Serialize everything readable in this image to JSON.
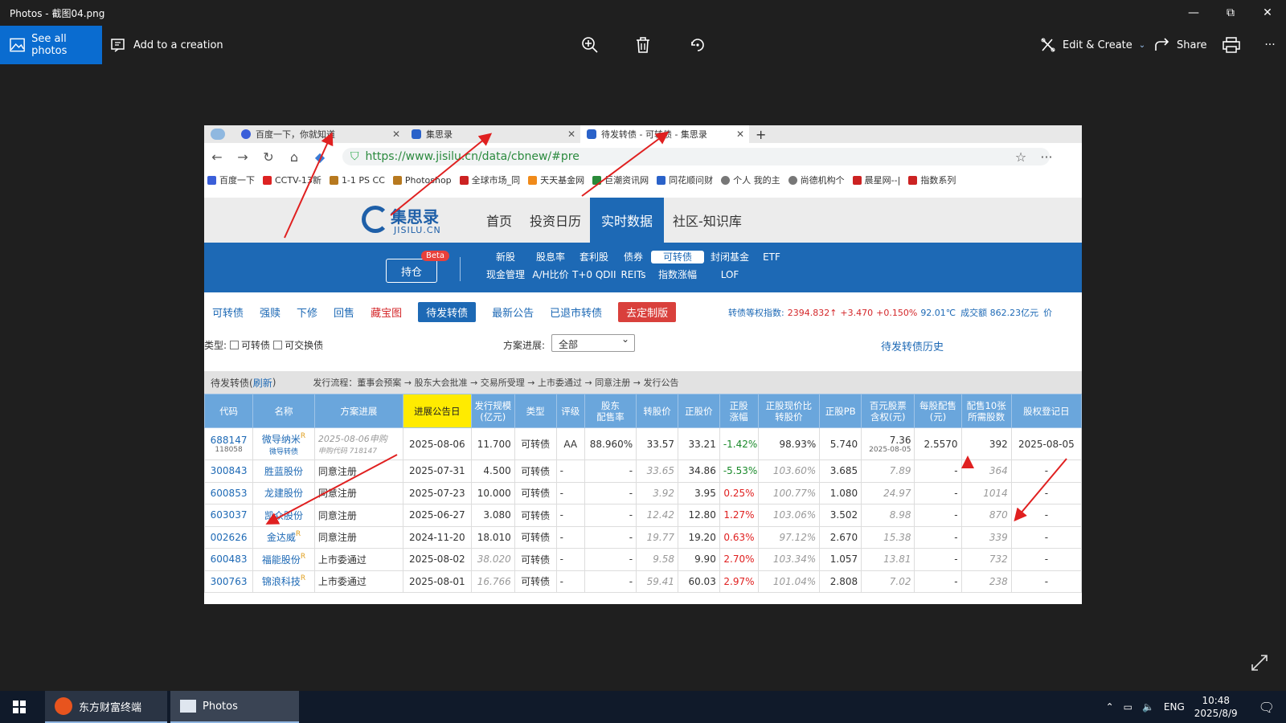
{
  "window": {
    "title": "Photos - 截图04.png",
    "minimize": "—",
    "maximize": "⧉",
    "close": "✕"
  },
  "toolbar": {
    "see_all": "See all photos",
    "add_creation": "Add to a creation",
    "edit_create": "Edit & Create",
    "share": "Share",
    "more": "···"
  },
  "browser": {
    "tabs": [
      "百度一下，你就知道",
      "集思录",
      "待发转债 - 可转债 - 集思录"
    ],
    "new_tab": "+",
    "url": "https://www.jisilu.cn/data/cbnew/#pre",
    "bookmarks": [
      "百度一下",
      "CCTV-13新",
      "1-1 PS CC",
      "Photoshop",
      "全球市场_同",
      "天天基金网",
      "巨潮资讯网",
      "同花顺问财",
      "个人 我的主",
      "尚德机构个",
      "晨星网--|",
      "指数系列"
    ]
  },
  "site": {
    "logo_cn": "集思录",
    "logo_en": "JISILU.CN",
    "nav": [
      "首页",
      "投资日历",
      "实时数据",
      "社区-知识库"
    ],
    "holding": "持仓",
    "beta": "Beta",
    "sub_row1": [
      "新股",
      "股息率",
      "套利股",
      "债券",
      "可转债",
      "封闭基金",
      "ETF"
    ],
    "sub_row2": [
      "现金管理",
      "A/H比价",
      "T+0 QDII",
      "REITs",
      "指数涨幅",
      "LOF",
      ""
    ],
    "filters": [
      "可转债",
      "强赎",
      "下修",
      "回售",
      "藏宝图",
      "待发转债",
      "最新公告",
      "已退市转债",
      "去定制版"
    ],
    "index_label": "转债等权指数:",
    "index_values": [
      "2394.832↑",
      "+3.470",
      "+0.150%",
      "92.01℃",
      "成交额 862.23亿元",
      "价"
    ],
    "type_label": "类型:",
    "type_opts": [
      "可转债",
      "可交换债"
    ],
    "progress_label": "方案进展:",
    "progress_value": "全部",
    "history": "待发转债历史",
    "section_title": "待发转债(",
    "refresh": "刷新",
    "section_close": ")",
    "flow": "发行流程：董事会预案 → 股东大会批准 → 交易所受理 → 上市委通过 → 同意注册 → 发行公告"
  },
  "table": {
    "headers": [
      "代码",
      "名称",
      "方案进展",
      "进展公告日",
      "发行规模\n(亿元)",
      "类型",
      "评级",
      "股东\n配售率",
      "转股价",
      "正股价",
      "正股\n涨幅",
      "正股现价比\n转股价",
      "正股PB",
      "百元股票\n含权(元)",
      "每股配售\n(元)",
      "配售10张\n所需股数",
      "股权登记日"
    ],
    "first": {
      "code": "688147",
      "subcode": "118058",
      "name": "微导纳米",
      "subname": "微导转债",
      "progress": "2025-08-06申购",
      "subprogress": "申购代码 718147",
      "date": "2025-08-06",
      "size": "11.700",
      "type": "可转债",
      "rating": "AA",
      "placement": "88.960%",
      "conv": "33.57",
      "price": "33.21",
      "chg": "-1.42%",
      "ratio": "98.93%",
      "pb": "5.740",
      "per100": "7.36",
      "per100date": "2025-08-05",
      "perShare": "2.5570",
      "need": "392",
      "record": "2025-08-05"
    },
    "rows": [
      [
        "300843",
        "胜蓝股份",
        "同意注册",
        "2025-07-31",
        "4.500",
        "可转债",
        "-",
        "-",
        "33.65",
        "34.86",
        "-5.53%",
        "103.60%",
        "3.685",
        "7.89",
        "-",
        "364",
        "-"
      ],
      [
        "600853",
        "龙建股份",
        "同意注册",
        "2025-07-23",
        "10.000",
        "可转债",
        "-",
        "-",
        "3.92",
        "3.95",
        "0.25%",
        "100.77%",
        "1.080",
        "24.97",
        "-",
        "1014",
        "-"
      ],
      [
        "603037",
        "凯众股份",
        "同意注册",
        "2025-06-27",
        "3.080",
        "可转债",
        "-",
        "-",
        "12.42",
        "12.80",
        "1.27%",
        "103.06%",
        "3.502",
        "8.98",
        "-",
        "870",
        "-"
      ],
      [
        "002626",
        "金达威",
        "同意注册",
        "2024-11-20",
        "18.010",
        "可转债",
        "-",
        "-",
        "19.77",
        "19.20",
        "0.63%",
        "97.12%",
        "2.670",
        "15.38",
        "-",
        "339",
        "-"
      ],
      [
        "600483",
        "福能股份",
        "上市委通过",
        "2025-08-02",
        "38.020",
        "可转债",
        "-",
        "-",
        "9.58",
        "9.90",
        "2.70%",
        "103.34%",
        "1.057",
        "13.81",
        "-",
        "732",
        "-"
      ],
      [
        "300763",
        "锦浪科技",
        "上市委通过",
        "2025-08-01",
        "16.766",
        "可转债",
        "-",
        "-",
        "59.41",
        "60.03",
        "2.97%",
        "101.04%",
        "2.808",
        "7.02",
        "-",
        "238",
        "-"
      ]
    ]
  },
  "taskbar": {
    "app1": "东方财富终端",
    "app2": "Photos",
    "lang": "ENG",
    "time": "10:48",
    "date": "2025/8/9"
  },
  "colors": {
    "accent": "#0a6cd0",
    "site_blue": "#1d69b5",
    "red": "#e02020",
    "green": "#1a8a2a",
    "highlight": "#ffeb00"
  }
}
